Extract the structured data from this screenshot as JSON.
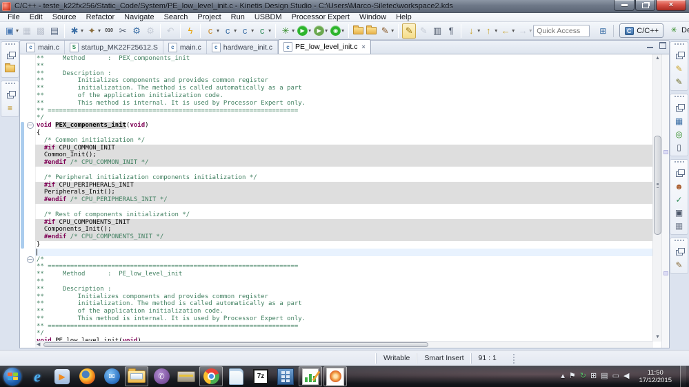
{
  "window": {
    "title": "C/C++ - teste_k22fx256/Static_Code/System/PE_low_level_init.c - Kinetis Design Studio - C:\\Users\\Marco-Siletec\\workspace2.kds"
  },
  "menu_bar": {
    "items": [
      "File",
      "Edit",
      "Source",
      "Refactor",
      "Navigate",
      "Search",
      "Project",
      "Run",
      "USBDM",
      "Processor Expert",
      "Window",
      "Help"
    ]
  },
  "toolbar": {
    "quick_access_placeholder": "Quick Access",
    "perspectives": [
      {
        "label": "C/C++",
        "active": true
      },
      {
        "label": "Debug",
        "active": false
      }
    ],
    "items": [
      {
        "name": "new-wizard-button",
        "glyph": "▣",
        "color": "#4a7ab5",
        "dropdown": true
      },
      {
        "name": "save-button",
        "glyph": "▦",
        "color": "#8a93a5",
        "disabled": true
      },
      {
        "name": "save-all-button",
        "glyph": "▩",
        "color": "#8a93a5",
        "disabled": true
      },
      {
        "name": "print-button",
        "glyph": "▤",
        "color": "#5b6b84"
      },
      {
        "type": "sep"
      },
      {
        "name": "manage-configurations-button",
        "glyph": "✱",
        "color": "#3a6ea5",
        "dropdown": true
      },
      {
        "name": "build-button",
        "glyph": "✦",
        "color": "#8a6d3b",
        "dropdown": true
      },
      {
        "name": "binary-file-button",
        "glyph": "010",
        "color": "#333333",
        "small": true
      },
      {
        "name": "scalpel-button",
        "glyph": "✂",
        "color": "#4a5568"
      },
      {
        "name": "debug-settings-gear-button",
        "glyph": "⚙",
        "color": "#3a6ea5"
      },
      {
        "name": "external-tool-button",
        "glyph": "⚙",
        "color": "#9aa3b2",
        "disabled": true
      },
      {
        "type": "sep"
      },
      {
        "name": "restart-button",
        "glyph": "↶",
        "color": "#9aa3b2",
        "disabled": true
      },
      {
        "type": "sep"
      },
      {
        "name": "flash-programmer-button",
        "glyph": "ϟ",
        "color": "#e8a000"
      },
      {
        "type": "sep"
      },
      {
        "name": "new-project-wizard-button",
        "glyph": "c",
        "color": "#c98a2a",
        "dropdown": true
      },
      {
        "name": "new-build-target-button",
        "glyph": "c",
        "color": "#3a6ea5",
        "dropdown": true
      },
      {
        "name": "new-source-file-button",
        "glyph": "c",
        "color": "#3a6ea5",
        "dropdown": true
      },
      {
        "name": "new-class-button",
        "glyph": "c",
        "color": "#2e8b57",
        "dropdown": true
      },
      {
        "type": "sep"
      },
      {
        "name": "debug-button",
        "glyph": "✳",
        "color": "#2e8b22",
        "dropdown": true
      },
      {
        "name": "run-button",
        "type": "round",
        "glyph": "▶",
        "color": "#2db52d",
        "dropdown": true
      },
      {
        "name": "run-external-button",
        "type": "round",
        "glyph": "▶",
        "color": "#6aa84f",
        "dropdown": true
      },
      {
        "name": "profile-button",
        "type": "round",
        "glyph": "◉",
        "color": "#2db52d",
        "dropdown": true
      },
      {
        "type": "sep"
      },
      {
        "name": "open-folder-button",
        "type": "folder"
      },
      {
        "name": "open-project-button",
        "type": "folder"
      },
      {
        "name": "code-brush-button",
        "glyph": "✎",
        "color": "#8a5a2a",
        "dropdown": true
      },
      {
        "type": "sep"
      },
      {
        "name": "mark-occurrences-button",
        "glyph": "✎",
        "color": "#a07a10",
        "active": true
      },
      {
        "name": "remove-occurrence-annotations-button",
        "glyph": "✎",
        "color": "#9aa3b2",
        "disabled": true
      },
      {
        "name": "block-selection-button",
        "glyph": "▥",
        "color": "#4a5568"
      },
      {
        "name": "show-whitespace-button",
        "glyph": "¶",
        "color": "#4a5568"
      },
      {
        "type": "sep"
      },
      {
        "name": "last-edit-location-button",
        "glyph": "↓",
        "color": "#c9a227",
        "dropdown": true
      },
      {
        "name": "next-annotation-button",
        "glyph": "↑",
        "color": "#c9a227",
        "dropdown": true
      },
      {
        "name": "back-button",
        "glyph": "←",
        "color": "#c9a227",
        "dropdown": true
      },
      {
        "name": "forward-button",
        "glyph": "→",
        "color": "#9aa3b2",
        "disabled": true,
        "dropdown": true
      }
    ]
  },
  "left_strip": [
    {
      "items": [
        {
          "name": "restore-project-explorer-button",
          "type": "restore"
        },
        {
          "name": "project-explorer-folder-icon",
          "type": "folder"
        }
      ]
    },
    {
      "items": [
        {
          "name": "restore-outline-left-button",
          "type": "restore"
        },
        {
          "name": "outline-tree-icon",
          "glyph": "≡",
          "color": "#b8860b"
        }
      ]
    }
  ],
  "right_strip": [
    {
      "items": [
        {
          "name": "restore-pencil-views-button",
          "type": "restore"
        },
        {
          "name": "pencil-icon",
          "glyph": "✎",
          "color": "#c9a227"
        },
        {
          "name": "pencil-dark-icon",
          "glyph": "✎",
          "color": "#6d6d2a"
        }
      ]
    },
    {
      "items": [
        {
          "name": "restore-components-button",
          "type": "restore"
        },
        {
          "name": "components-icon",
          "glyph": "▦",
          "color": "#3a6ea5"
        },
        {
          "name": "target-icon",
          "glyph": "◎",
          "color": "#2e8b22"
        },
        {
          "name": "device-icon",
          "glyph": "▯",
          "color": "#4a5568"
        }
      ]
    },
    {
      "items": [
        {
          "name": "restore-console-group-button",
          "type": "restore"
        },
        {
          "name": "person-icon",
          "glyph": "☻",
          "color": "#a85a2a"
        },
        {
          "name": "tasks-check-icon",
          "glyph": "✓",
          "color": "#2e8b57"
        },
        {
          "name": "console-monitor-icon",
          "glyph": "▣",
          "color": "#4a5568"
        },
        {
          "name": "properties-table-icon",
          "glyph": "▦",
          "color": "#7a8394"
        }
      ]
    },
    {
      "items": [
        {
          "name": "restore-bottom-view-button",
          "type": "restore"
        },
        {
          "name": "pen-icon",
          "glyph": "✎",
          "color": "#8a6d3b"
        }
      ]
    }
  ],
  "editor_tabs": [
    {
      "label": "main.c",
      "icon": "c",
      "active": false
    },
    {
      "label": "startup_MK22F25612.S",
      "icon": "S",
      "active": false
    },
    {
      "label": "main.c",
      "icon": "c",
      "active": false
    },
    {
      "label": "hardware_init.c",
      "icon": "c",
      "active": false
    },
    {
      "label": "PE_low_level_init.c",
      "icon": "c",
      "active": true,
      "close_glyph": "×"
    }
  ],
  "editor": {
    "caret_line": 26,
    "fold_lines": [
      9,
      27
    ],
    "range": {
      "start": 9,
      "end": 25
    },
    "scrollbar": {
      "thumb_top": 0.27,
      "thumb_height": 0.36
    },
    "overview_marks": [
      0.33,
      0.75
    ],
    "lines": [
      {
        "s": [
          [
            "c",
            "**     Method      :  PEX_components_init"
          ]
        ]
      },
      {
        "s": [
          [
            "c",
            "**"
          ]
        ]
      },
      {
        "s": [
          [
            "c",
            "**     Description :"
          ]
        ]
      },
      {
        "s": [
          [
            "c",
            "**         Initializes components and provides common register"
          ]
        ]
      },
      {
        "s": [
          [
            "c",
            "**         initialization. The method is called automatically as a part"
          ]
        ]
      },
      {
        "s": [
          [
            "c",
            "**         of the application initialization code."
          ]
        ]
      },
      {
        "s": [
          [
            "c",
            "**         This method is internal. It is used by Processor Expert only."
          ]
        ]
      },
      {
        "s": [
          [
            "c",
            "** ==================================================================="
          ]
        ]
      },
      {
        "s": [
          [
            "c",
            "*/"
          ]
        ]
      },
      {
        "s": [
          [
            "k",
            "void "
          ],
          [
            "o",
            "PEX_components_init"
          ],
          [
            "p",
            "("
          ],
          [
            "k",
            "void"
          ],
          [
            "p",
            ")"
          ]
        ]
      },
      {
        "s": [
          [
            "p",
            "{"
          ]
        ]
      },
      {
        "s": [
          [
            "p",
            "  "
          ],
          [
            "c",
            "/* Common initialization */"
          ]
        ]
      },
      {
        "g": 1,
        "s": [
          [
            "p",
            "  "
          ],
          [
            "k",
            "#if"
          ],
          [
            "p",
            " CPU_COMMON_INIT"
          ]
        ]
      },
      {
        "g": 1,
        "s": [
          [
            "p",
            "  Common_Init();"
          ]
        ]
      },
      {
        "g": 1,
        "s": [
          [
            "p",
            "  "
          ],
          [
            "k",
            "#endif"
          ],
          [
            "p",
            " "
          ],
          [
            "c",
            "/* CPU_COMMON_INIT */"
          ]
        ]
      },
      {
        "s": []
      },
      {
        "s": [
          [
            "p",
            "  "
          ],
          [
            "c",
            "/* Peripheral initialization components initialization */"
          ]
        ]
      },
      {
        "g": 1,
        "s": [
          [
            "p",
            "  "
          ],
          [
            "k",
            "#if"
          ],
          [
            "p",
            " CPU_PERIPHERALS_INIT"
          ]
        ]
      },
      {
        "g": 1,
        "s": [
          [
            "p",
            "  Peripherals_Init();"
          ]
        ]
      },
      {
        "g": 1,
        "s": [
          [
            "p",
            "  "
          ],
          [
            "k",
            "#endif"
          ],
          [
            "p",
            " "
          ],
          [
            "c",
            "/* CPU_PERIPHERALS_INIT */"
          ]
        ]
      },
      {
        "s": []
      },
      {
        "s": [
          [
            "p",
            "  "
          ],
          [
            "c",
            "/* Rest of components initialization */"
          ]
        ]
      },
      {
        "g": 1,
        "s": [
          [
            "p",
            "  "
          ],
          [
            "k",
            "#if"
          ],
          [
            "p",
            " CPU_COMPONENTS_INIT"
          ]
        ]
      },
      {
        "g": 1,
        "s": [
          [
            "p",
            "  Components_Init();"
          ]
        ]
      },
      {
        "g": 1,
        "s": [
          [
            "p",
            "  "
          ],
          [
            "k",
            "#endif"
          ],
          [
            "p",
            " "
          ],
          [
            "c",
            "/* CPU_COMPONENTS_INIT */"
          ]
        ]
      },
      {
        "s": [
          [
            "p",
            "}"
          ]
        ]
      },
      {
        "s": []
      },
      {
        "s": [
          [
            "c",
            "/*"
          ]
        ]
      },
      {
        "s": [
          [
            "c",
            "** ==================================================================="
          ]
        ]
      },
      {
        "s": [
          [
            "c",
            "**     Method      :  PE_low_level_init"
          ]
        ]
      },
      {
        "s": [
          [
            "c",
            "**"
          ]
        ]
      },
      {
        "s": [
          [
            "c",
            "**     Description :"
          ]
        ]
      },
      {
        "s": [
          [
            "c",
            "**         Initializes components and provides common register"
          ]
        ]
      },
      {
        "s": [
          [
            "c",
            "**         initialization. The method is called automatically as a part"
          ]
        ]
      },
      {
        "s": [
          [
            "c",
            "**         of the application initialization code."
          ]
        ]
      },
      {
        "s": [
          [
            "c",
            "**         This method is internal. It is used by Processor Expert only."
          ]
        ]
      },
      {
        "s": [
          [
            "c",
            "** ==================================================================="
          ]
        ]
      },
      {
        "s": [
          [
            "c",
            "*/"
          ]
        ]
      },
      {
        "s": [
          [
            "k",
            "void "
          ],
          [
            "p",
            "PE_low_level_init("
          ],
          [
            "k",
            "void"
          ],
          [
            "p",
            ")"
          ]
        ]
      }
    ]
  },
  "status_bar": {
    "writable": "Writable",
    "smart_insert": "Smart Insert",
    "position": "91 : 1"
  },
  "taskbar": {
    "apps": [
      {
        "name": "start-button",
        "type": "start"
      },
      {
        "name": "internet-explorer-icon",
        "type": "ie"
      },
      {
        "name": "media-player-icon",
        "type": "wmp"
      },
      {
        "name": "firefox-icon",
        "type": "firefox"
      },
      {
        "name": "thunderbird-icon",
        "type": "thunderbird"
      },
      {
        "name": "windows-explorer-icon",
        "type": "explorer",
        "open": true
      },
      {
        "name": "viber-icon",
        "type": "viber"
      },
      {
        "name": "tool-icon",
        "type": "tool"
      },
      {
        "name": "chrome-icon",
        "type": "chrome",
        "open": true
      },
      {
        "name": "notepad-icon",
        "type": "notepad"
      },
      {
        "name": "7zip-icon",
        "type": "7z"
      },
      {
        "name": "building-app-icon",
        "type": "building"
      },
      {
        "name": "chart-app-icon",
        "type": "chart",
        "open": true
      },
      {
        "name": "network-app-icon",
        "type": "orange",
        "open": true
      }
    ],
    "tray": [
      {
        "name": "show-hidden-icons-button",
        "glyph": "▴"
      },
      {
        "name": "action-center-flag-icon",
        "glyph": "⚑"
      },
      {
        "name": "windows-update-icon",
        "glyph": "↻",
        "color": "#58c06a"
      },
      {
        "name": "grid-icon",
        "glyph": "⊞"
      },
      {
        "name": "clipboard-icon",
        "glyph": "▤"
      },
      {
        "name": "display-icon",
        "glyph": "▭"
      },
      {
        "name": "speaker-icon",
        "glyph": "◀"
      }
    ],
    "clock": {
      "time": "11:50",
      "date": "17/12/2015"
    }
  }
}
